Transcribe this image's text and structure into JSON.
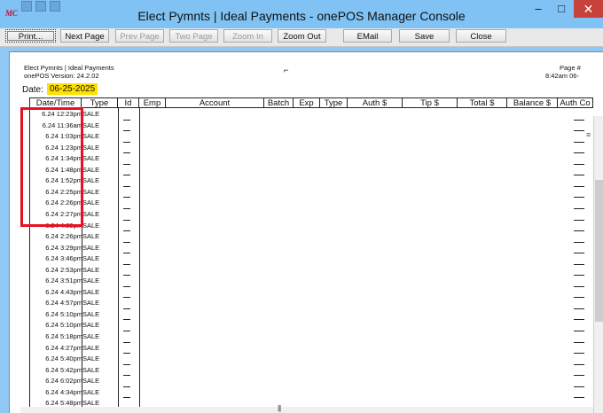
{
  "window": {
    "app_icon": "MC",
    "title": "Elect Pymnts | Ideal Payments - onePOS Manager Console",
    "minimize": "–",
    "maximize": "□",
    "close": "✕"
  },
  "toolbar": {
    "print": "Print...",
    "next_page": "Next Page",
    "prev_page": "Prev Page",
    "two_page": "Two Page",
    "zoom_in": "Zoom In",
    "zoom_out": "Zoom Out",
    "email": "EMail",
    "save": "Save",
    "close": "Close"
  },
  "report": {
    "header_left_1": "Elect Pymnts | Ideal Payments",
    "header_left_2": "onePOS Version: 24.2.02",
    "header_right_1": "Page #",
    "header_right_2": "8:42am 06-",
    "date_label": "Date:",
    "date_value": "06-25-2025",
    "columns": [
      "Date/Time",
      "Type",
      "Id",
      "Emp",
      "Account",
      "Batch",
      "Exp",
      "Type",
      "Auth $",
      "Tip $",
      "Total $",
      "Balance $",
      "Auth Co"
    ],
    "rows": [
      {
        "dt": "6.24 12:23pm",
        "type": "SALE"
      },
      {
        "dt": "6.24 11:36am",
        "type": "SALE"
      },
      {
        "dt": "6.24 1:03pm",
        "type": "SALE"
      },
      {
        "dt": "6.24 1:23pm",
        "type": "SALE"
      },
      {
        "dt": "6.24 1:34pm",
        "type": "SALE"
      },
      {
        "dt": "6.24 1:48pm",
        "type": "SALE"
      },
      {
        "dt": "6.24 1:52pm",
        "type": "SALE"
      },
      {
        "dt": "6.24 2:25pm",
        "type": "SALE"
      },
      {
        "dt": "6.24 2:26pm",
        "type": "SALE"
      },
      {
        "dt": "6.24 2:27pm",
        "type": "SALE"
      },
      {
        "dt": "6.24 4:09pm",
        "type": "SALE"
      },
      {
        "dt": "6.24 2:26pm",
        "type": "SALE"
      },
      {
        "dt": "6.24 3:29pm",
        "type": "SALE"
      },
      {
        "dt": "6.24 3:46pm",
        "type": "SALE"
      },
      {
        "dt": "6.24 2:53pm",
        "type": "SALE"
      },
      {
        "dt": "6.24 3:51pm",
        "type": "SALE"
      },
      {
        "dt": "6.24 4:43pm",
        "type": "SALE"
      },
      {
        "dt": "6.24 4:57pm",
        "type": "SALE"
      },
      {
        "dt": "6.24 5:10pm",
        "type": "SALE"
      },
      {
        "dt": "6.24 5:10pm",
        "type": "SALE"
      },
      {
        "dt": "6.24 5:18pm",
        "type": "SALE"
      },
      {
        "dt": "6.24 4:27pm",
        "type": "SALE"
      },
      {
        "dt": "6.24 5:40pm",
        "type": "SALE"
      },
      {
        "dt": "6.24 5:42pm",
        "type": "SALE"
      },
      {
        "dt": "6.24 6:02pm",
        "type": "SALE"
      },
      {
        "dt": "6.24 4:34pm",
        "type": "SALE"
      },
      {
        "dt": "6.24 5:48pm",
        "type": "SALE"
      }
    ]
  },
  "colors": {
    "titlebar": "#7fc2f3",
    "close_button": "#c7423b",
    "date_highlight": "#ffe000",
    "annotation_box": "#e81123"
  }
}
